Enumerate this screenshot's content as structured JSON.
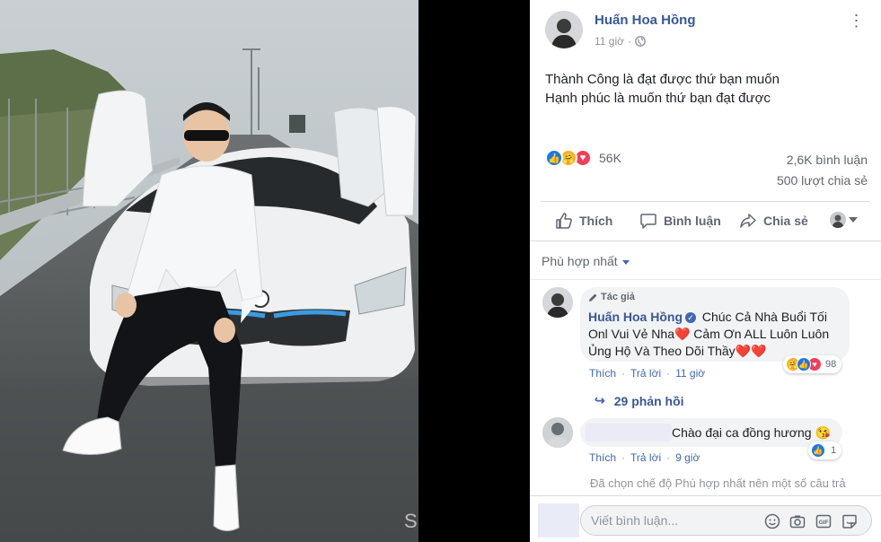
{
  "photo": {
    "watermark": "S"
  },
  "post": {
    "author": "Huấn Hoa Hồng",
    "time": "11 giờ",
    "privacy_icon": "globe-icon",
    "text_lines": [
      "Thành Công là đạt được thứ bạn muốn",
      "Hạnh phúc là muốn thứ bạn đạt được"
    ],
    "reaction_count": "56K",
    "comment_count": "2,6K bình luận",
    "share_count": "500 lượt chia sẻ"
  },
  "actions": {
    "like": "Thích",
    "comment": "Bình luận",
    "share": "Chia sẻ"
  },
  "sort": {
    "label": "Phù hợp nhất"
  },
  "comments": [
    {
      "badge": "Tác giả",
      "name": "Huấn Hoa Hồng",
      "text": "Chúc Cả Nhà Buổi Tối Onl Vui Vẻ Nha",
      "text2": " Cảm Ơn ALL Luôn Luôn Ủng Hộ Và Theo Dõi Thầy",
      "like": "Thích",
      "reply": "Trả lời",
      "time": "11 giờ",
      "reaction_count": "98",
      "replies": "29 phản hồi"
    },
    {
      "text": "Chào đại ca đồng hương 😘",
      "like": "Thích",
      "reply": "Trả lời",
      "time": "9 giờ",
      "reaction_count": "1"
    }
  ],
  "notice": "Đã chọn chế độ Phù hợp nhất nên một số câu trả",
  "composer": {
    "placeholder": "Viết bình luận..."
  },
  "colors": {
    "link": "#365899",
    "accent": "#4267b2",
    "love": "#f33e58",
    "care": "#f7b125"
  }
}
